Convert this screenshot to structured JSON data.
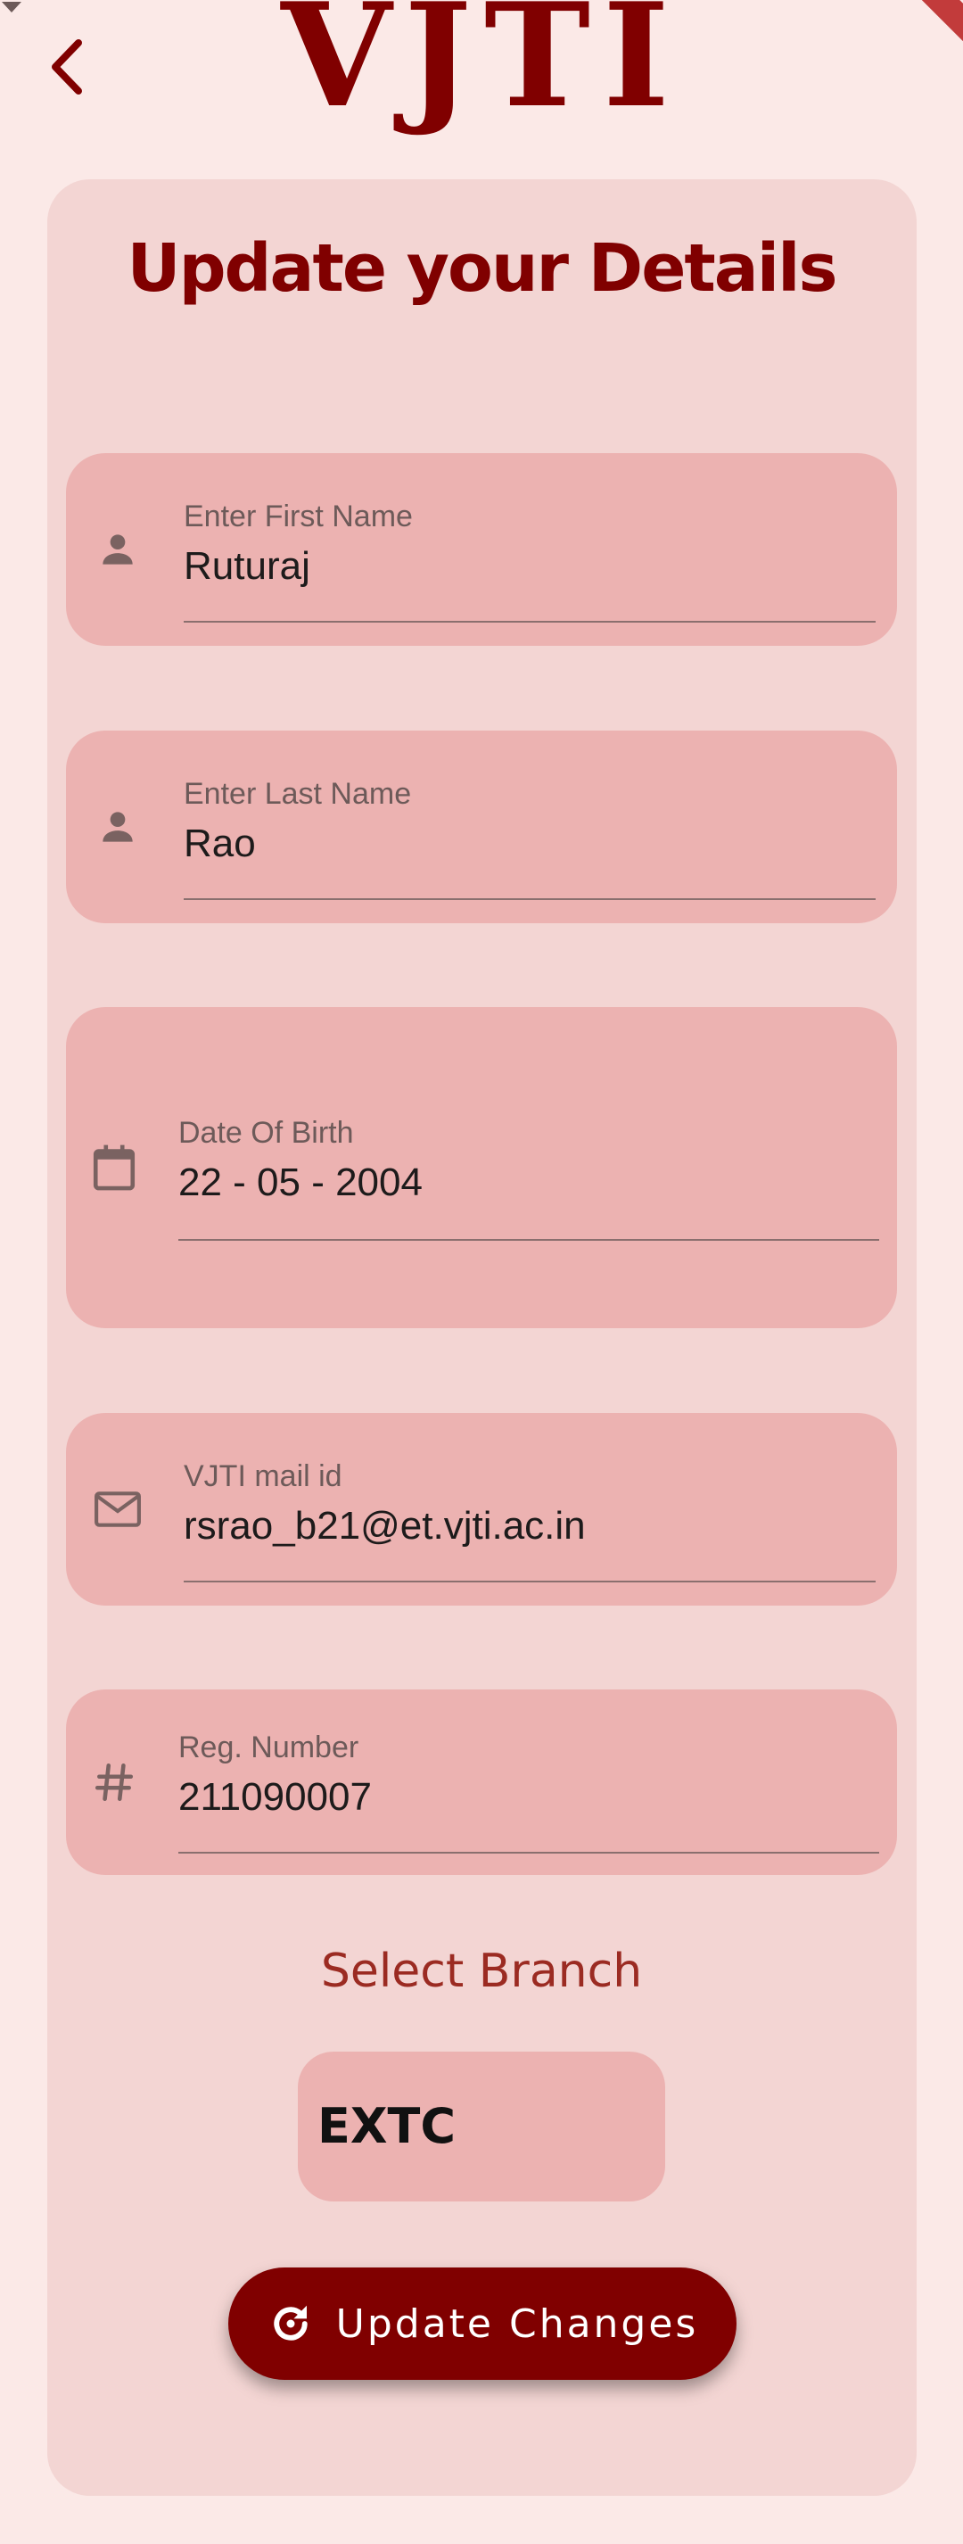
{
  "app_bar": {
    "logo_text": "VJTI",
    "back_icon": "chevron-left-icon"
  },
  "form": {
    "title": "Update your Details",
    "first_name": {
      "label": "Enter First Name",
      "value": "Ruturaj",
      "icon": "person-icon"
    },
    "last_name": {
      "label": "Enter Last Name",
      "value": "Rao",
      "icon": "person-icon"
    },
    "dob": {
      "label": "Date Of Birth",
      "value": "22 - 05 - 2004",
      "icon": "calendar-icon"
    },
    "email": {
      "label": "VJTI mail id",
      "value": "rsrao_b21@et.vjti.ac.in",
      "icon": "mail-icon"
    },
    "reg_number": {
      "label": "Reg. Number",
      "value": "211090007",
      "icon": "hash-icon"
    },
    "branch_heading": "Select Branch",
    "branch": {
      "selected": "EXTC",
      "icon": "dropdown-arrow-icon"
    },
    "update_button": {
      "label": "Update Changes",
      "icon": "refresh-icon"
    }
  },
  "colors": {
    "background": "#fbe9e7",
    "card": "#f3d5d3",
    "field": "#ecb2b1",
    "primary": "#800000",
    "branch_heading": "#9b2b22"
  }
}
